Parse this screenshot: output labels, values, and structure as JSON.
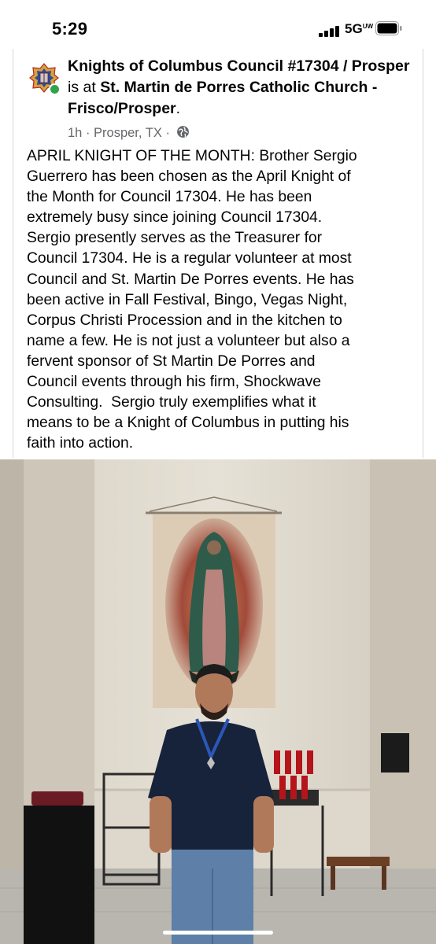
{
  "status_bar": {
    "time": "5:29",
    "network": "5G",
    "network_suffix": "UW"
  },
  "post": {
    "author": "Knights of Columbus Council #17304 / Prosper",
    "connector": " is at ",
    "place": "St. Martin de Porres Catholic Church - Frisco/Prosper",
    "period": ".",
    "time": "1h",
    "separator": " · ",
    "location": "Prosper, TX",
    "audience_icon": "globe-icon",
    "body": "APRIL KNIGHT OF THE MONTH: Brother Sergio\nGuerrero has been chosen as the April Knight of\nthe Month for Council 17304. He has been\nextremely busy since joining Council 17304.\nSergio presently serves as the Treasurer for\nCouncil 17304. He is a regular volunteer at most\nCouncil and St. Martin De Porres events. He has\nbeen active in Fall Festival, Bingo, Vegas Night,\nCorpus Christi Procession and in the kitchen to\nname a few. He is not just a volunteer but also a\nfervent sponsor of St Martin De Porres and\nCouncil events through his firm, Shockwave\nConsulting.  Sergio truly exemplifies what it\nmeans to be a Knight of Columbus in putting his\nfaith into action."
  },
  "colors": {
    "online": "#31a24c",
    "meta_text": "#65676b"
  }
}
